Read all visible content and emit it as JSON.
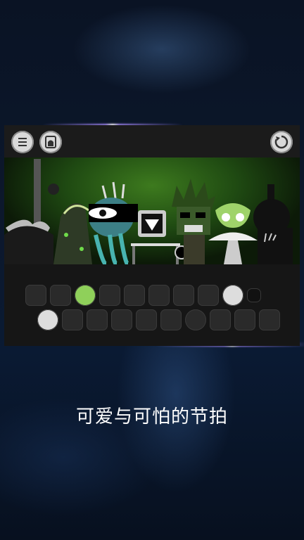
{
  "caption": "可爱与可怕的节拍",
  "toolbar": {
    "left_buttons": [
      "menu-icon",
      "gallery-icon"
    ],
    "right_buttons": [
      "restart-icon"
    ]
  },
  "stage": {
    "characters": [
      "ghost-creature",
      "robed-figure",
      "eye-creature",
      "computer-guy",
      "spiky-hair-creature",
      "alien-creature",
      "horned-shadow"
    ]
  },
  "sound_icons": [
    "wing-icon",
    "blade-icon",
    "alien-head-icon",
    "robot-icon",
    "spike-icon",
    "glove-icon",
    "whisk-icon",
    "goggles-icon",
    "swirl-icon",
    "dot-icon",
    "sun-icon",
    "arch-icon",
    "slash-icon",
    "bird-icon",
    "capsule-icon",
    "tv-icon",
    "ring-icon",
    "crescent-icon",
    "hood-icon",
    "hat-icon"
  ],
  "colors": {
    "accent": "#3d7a1e",
    "caption": "#ffffff"
  }
}
